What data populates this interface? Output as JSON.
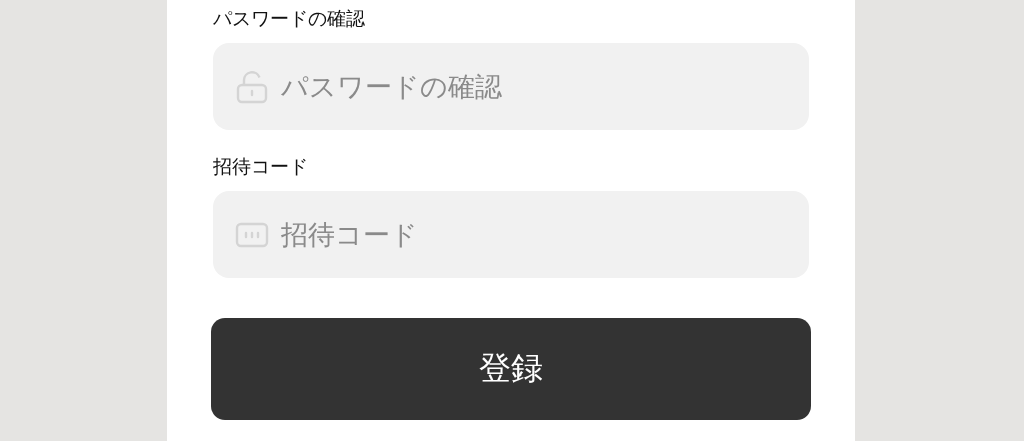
{
  "fields": [
    {
      "label": "パスワードの確認",
      "placeholder": "パスワードの確認",
      "kind": "password"
    },
    {
      "label": "招待コード",
      "placeholder": "招待コード",
      "kind": "code"
    }
  ],
  "submit_button": "登録"
}
